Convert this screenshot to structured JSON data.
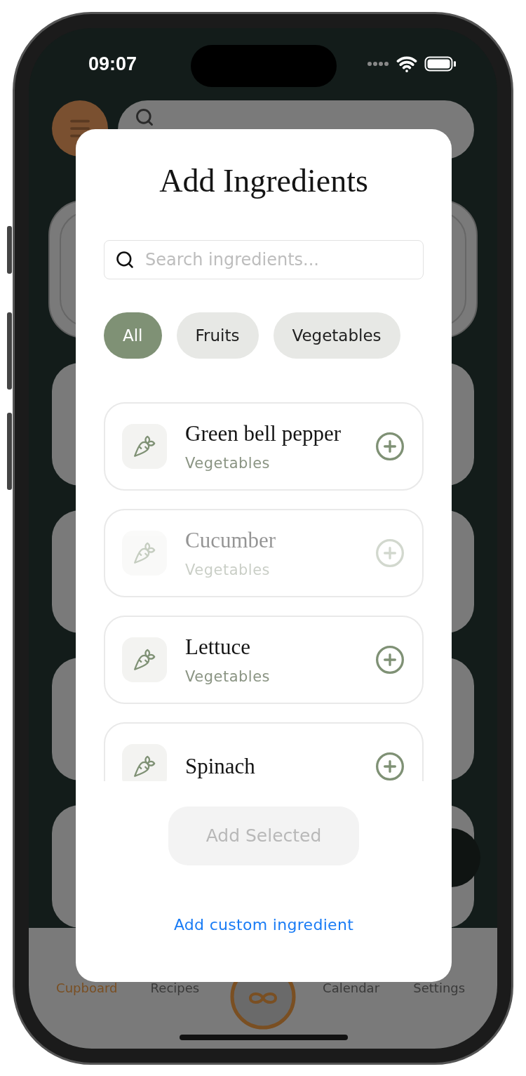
{
  "status_bar": {
    "time": "09:07"
  },
  "tab_bar": {
    "tabs": [
      {
        "label": "Cupboard",
        "selected": true
      },
      {
        "label": "Recipes",
        "selected": false
      },
      {
        "label": "Calendar",
        "selected": false
      },
      {
        "label": "Settings",
        "selected": false
      }
    ]
  },
  "dialog": {
    "title": "Add Ingredients",
    "search": {
      "placeholder": "Search ingredients..."
    },
    "filters": [
      {
        "label": "All",
        "selected": true
      },
      {
        "label": "Fruits",
        "selected": false
      },
      {
        "label": "Vegetables",
        "selected": false
      }
    ],
    "ingredients": [
      {
        "name": "Green bell pepper",
        "category": "Vegetables",
        "dimmed": false
      },
      {
        "name": "Cucumber",
        "category": "Vegetables",
        "dimmed": true
      },
      {
        "name": "Lettuce",
        "category": "Vegetables",
        "dimmed": false
      },
      {
        "name": "Spinach",
        "dimmed": false
      }
    ],
    "add_button": {
      "label": "Add Selected",
      "disabled": true
    },
    "custom_link": "Add custom ingredient"
  }
}
